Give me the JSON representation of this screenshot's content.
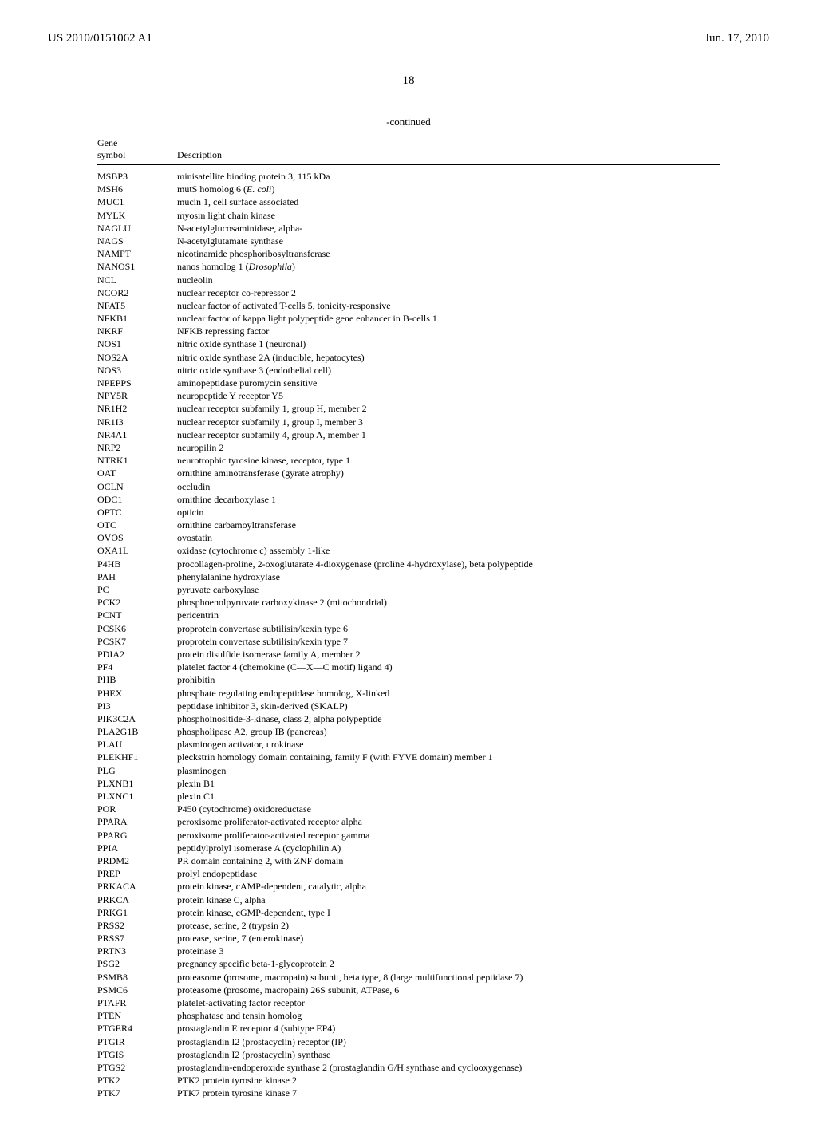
{
  "header": {
    "left": "US 2010/0151062 A1",
    "right": "Jun. 17, 2010"
  },
  "page_number": "18",
  "table": {
    "continued_label": "-continued",
    "col1_label": "Gene\nsymbol",
    "col2_label": "Description",
    "rows": [
      {
        "sym": "MSBP3",
        "desc": "minisatellite binding protein 3, 115 kDa"
      },
      {
        "sym": "MSH6",
        "desc": "mutS homolog 6 (<i>E. coli</i>)"
      },
      {
        "sym": "MUC1",
        "desc": "mucin 1, cell surface associated"
      },
      {
        "sym": "MYLK",
        "desc": "myosin light chain kinase"
      },
      {
        "sym": "NAGLU",
        "desc": "N-acetylglucosaminidase, alpha-"
      },
      {
        "sym": "NAGS",
        "desc": "N-acetylglutamate synthase"
      },
      {
        "sym": "NAMPT",
        "desc": "nicotinamide phosphoribosyltransferase"
      },
      {
        "sym": "NANOS1",
        "desc": "nanos homolog 1 (<i>Drosophila</i>)"
      },
      {
        "sym": "NCL",
        "desc": "nucleolin"
      },
      {
        "sym": "NCOR2",
        "desc": "nuclear receptor co-repressor 2"
      },
      {
        "sym": "NFAT5",
        "desc": "nuclear factor of activated T-cells 5, tonicity-responsive"
      },
      {
        "sym": "NFKB1",
        "desc": "nuclear factor of kappa light polypeptide gene enhancer in B-cells 1"
      },
      {
        "sym": "NKRF",
        "desc": "NFKB repressing factor"
      },
      {
        "sym": "NOS1",
        "desc": "nitric oxide synthase 1 (neuronal)"
      },
      {
        "sym": "NOS2A",
        "desc": "nitric oxide synthase 2A (inducible, hepatocytes)"
      },
      {
        "sym": "NOS3",
        "desc": "nitric oxide synthase 3 (endothelial cell)"
      },
      {
        "sym": "NPEPPS",
        "desc": "aminopeptidase puromycin sensitive"
      },
      {
        "sym": "NPY5R",
        "desc": "neuropeptide Y receptor Y5"
      },
      {
        "sym": "NR1H2",
        "desc": "nuclear receptor subfamily 1, group H, member 2"
      },
      {
        "sym": "NR1I3",
        "desc": "nuclear receptor subfamily 1, group I, member 3"
      },
      {
        "sym": "NR4A1",
        "desc": "nuclear receptor subfamily 4, group A, member 1"
      },
      {
        "sym": "NRP2",
        "desc": "neuropilin 2"
      },
      {
        "sym": "NTRK1",
        "desc": "neurotrophic tyrosine kinase, receptor, type 1"
      },
      {
        "sym": "OAT",
        "desc": "ornithine aminotransferase (gyrate atrophy)"
      },
      {
        "sym": "OCLN",
        "desc": "occludin"
      },
      {
        "sym": "ODC1",
        "desc": "ornithine decarboxylase 1"
      },
      {
        "sym": "OPTC",
        "desc": "opticin"
      },
      {
        "sym": "OTC",
        "desc": "ornithine carbamoyltransferase"
      },
      {
        "sym": "OVOS",
        "desc": "ovostatin"
      },
      {
        "sym": "OXA1L",
        "desc": "oxidase (cytochrome c) assembly 1-like"
      },
      {
        "sym": "P4HB",
        "desc": "procollagen-proline, 2-oxoglutarate 4-dioxygenase (proline 4-hydroxylase), beta polypeptide"
      },
      {
        "sym": "PAH",
        "desc": "phenylalanine hydroxylase"
      },
      {
        "sym": "PC",
        "desc": "pyruvate carboxylase"
      },
      {
        "sym": "PCK2",
        "desc": "phosphoenolpyruvate carboxykinase 2 (mitochondrial)"
      },
      {
        "sym": "PCNT",
        "desc": "pericentrin"
      },
      {
        "sym": "PCSK6",
        "desc": "proprotein convertase subtilisin/kexin type 6"
      },
      {
        "sym": "PCSK7",
        "desc": "proprotein convertase subtilisin/kexin type 7"
      },
      {
        "sym": "PDIA2",
        "desc": "protein disulfide isomerase family A, member 2"
      },
      {
        "sym": "PF4",
        "desc": "platelet factor 4 (chemokine (C—X—C motif) ligand 4)"
      },
      {
        "sym": "PHB",
        "desc": "prohibitin"
      },
      {
        "sym": "PHEX",
        "desc": "phosphate regulating endopeptidase homolog, X-linked"
      },
      {
        "sym": "PI3",
        "desc": "peptidase inhibitor 3, skin-derived (SKALP)"
      },
      {
        "sym": "PIK3C2A",
        "desc": "phosphoinositide-3-kinase, class 2, alpha polypeptide"
      },
      {
        "sym": "PLA2G1B",
        "desc": "phospholipase A2, group IB (pancreas)"
      },
      {
        "sym": "PLAU",
        "desc": "plasminogen activator, urokinase"
      },
      {
        "sym": "PLEKHF1",
        "desc": "pleckstrin homology domain containing, family F (with FYVE domain) member 1"
      },
      {
        "sym": "PLG",
        "desc": "plasminogen"
      },
      {
        "sym": "PLXNB1",
        "desc": "plexin B1"
      },
      {
        "sym": "PLXNC1",
        "desc": "plexin C1"
      },
      {
        "sym": "POR",
        "desc": "P450 (cytochrome) oxidoreductase"
      },
      {
        "sym": "PPARA",
        "desc": "peroxisome proliferator-activated receptor alpha"
      },
      {
        "sym": "PPARG",
        "desc": "peroxisome proliferator-activated receptor gamma"
      },
      {
        "sym": "PPIA",
        "desc": "peptidylprolyl isomerase A (cyclophilin A)"
      },
      {
        "sym": "PRDM2",
        "desc": "PR domain containing 2, with ZNF domain"
      },
      {
        "sym": "PREP",
        "desc": "prolyl endopeptidase"
      },
      {
        "sym": "PRKACA",
        "desc": "protein kinase, cAMP-dependent, catalytic, alpha"
      },
      {
        "sym": "PRKCA",
        "desc": "protein kinase C, alpha"
      },
      {
        "sym": "PRKG1",
        "desc": "protein kinase, cGMP-dependent, type I"
      },
      {
        "sym": "PRSS2",
        "desc": "protease, serine, 2 (trypsin 2)"
      },
      {
        "sym": "PRSS7",
        "desc": "protease, serine, 7 (enterokinase)"
      },
      {
        "sym": "PRTN3",
        "desc": "proteinase 3"
      },
      {
        "sym": "PSG2",
        "desc": "pregnancy specific beta-1-glycoprotein 2"
      },
      {
        "sym": "PSMB8",
        "desc": "proteasome (prosome, macropain) subunit, beta type, 8 (large multifunctional peptidase 7)"
      },
      {
        "sym": "PSMC6",
        "desc": "proteasome (prosome, macropain) 26S subunit, ATPase, 6"
      },
      {
        "sym": "PTAFR",
        "desc": "platelet-activating factor receptor"
      },
      {
        "sym": "PTEN",
        "desc": "phosphatase and tensin homolog"
      },
      {
        "sym": "PTGER4",
        "desc": "prostaglandin E receptor 4 (subtype EP4)"
      },
      {
        "sym": "PTGIR",
        "desc": "prostaglandin I2 (prostacyclin) receptor (IP)"
      },
      {
        "sym": "PTGIS",
        "desc": "prostaglandin I2 (prostacyclin) synthase"
      },
      {
        "sym": "PTGS2",
        "desc": "prostaglandin-endoperoxide synthase 2 (prostaglandin G/H synthase and cyclooxygenase)"
      },
      {
        "sym": "PTK2",
        "desc": "PTK2 protein tyrosine kinase 2"
      },
      {
        "sym": "PTK7",
        "desc": "PTK7 protein tyrosine kinase 7"
      }
    ]
  }
}
